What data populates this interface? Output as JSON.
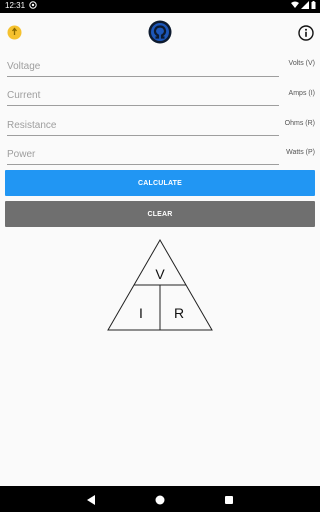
{
  "status_bar": {
    "time": "12:31"
  },
  "fields": [
    {
      "placeholder": "Voltage",
      "unit": "Volts (V)"
    },
    {
      "placeholder": "Current",
      "unit": "Amps (I)"
    },
    {
      "placeholder": "Resistance",
      "unit": "Ohms (R)"
    },
    {
      "placeholder": "Power",
      "unit": "Watts (P)"
    }
  ],
  "buttons": {
    "calculate": "CALCULATE",
    "clear": "CLEAR"
  },
  "triangle": {
    "top": "V",
    "left": "I",
    "right": "R"
  },
  "colors": {
    "primary": "#2196f3",
    "clear": "#6f6f6f",
    "accent_yellow": "#f5c12e",
    "logo_blue": "#1c56b8"
  }
}
